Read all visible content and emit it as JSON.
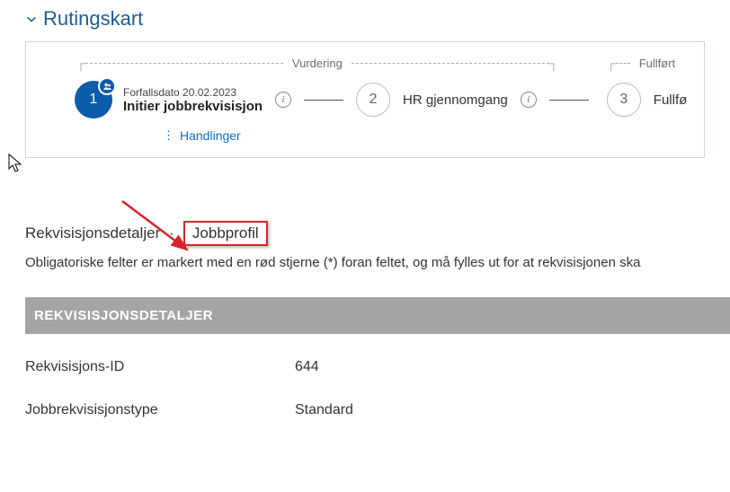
{
  "header": {
    "title": "Rutingskart"
  },
  "routing": {
    "groups": [
      {
        "label": "Vurdering"
      },
      {
        "label": "Fullført"
      }
    ],
    "steps": [
      {
        "number": "1",
        "title": "Initier jobbrekvisisjon",
        "due": "Forfallsdato 20.02.2023",
        "active": true
      },
      {
        "number": "2",
        "title": "HR gjennomgang",
        "active": false
      },
      {
        "number": "3",
        "title": "Fullfø",
        "active": false
      }
    ],
    "actions_label": "Handlinger"
  },
  "tabs": {
    "details_label": "Rekvisisjonsdetaljer",
    "profile_label": "Jobbprofil",
    "hint": "Obligatoriske felter er markert med en rød stjerne (*) foran feltet, og må fylles ut for at rekvisisjonen ska"
  },
  "section_header": "REKVISISJONSDETALJER",
  "details": [
    {
      "label": "Rekvisisjons-ID",
      "value": "644"
    },
    {
      "label": "Jobbrekvisisjonstype",
      "value": "Standard"
    }
  ]
}
